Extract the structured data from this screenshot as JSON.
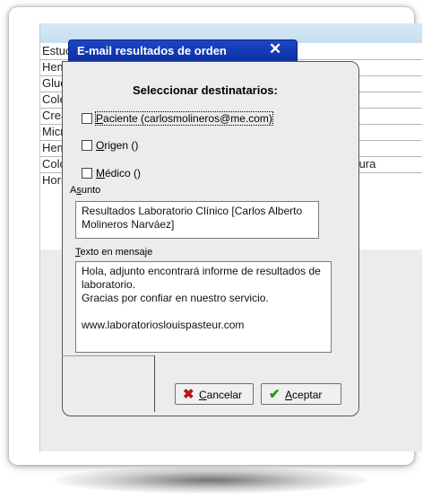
{
  "background_list": {
    "rows": [
      {
        "col1": "Estuc",
        "col2": ""
      },
      {
        "col1": "Hemo",
        "col2": ""
      },
      {
        "col1": "Gluco",
        "col2": "a"
      },
      {
        "col1": "Coles",
        "col2": ""
      },
      {
        "col1": "Creat",
        "col2": ""
      },
      {
        "col1": "Micro",
        "col2": ""
      },
      {
        "col1": "Hemo",
        "col2": "les"
      },
      {
        "col1": "Color",
        "col2": "Lectura"
      },
      {
        "col1": "Horm",
        "col2": ""
      }
    ]
  },
  "dialog": {
    "title": "E-mail resultados de orden",
    "close_glyph": "✕",
    "heading": "Seleccionar destinatarios:",
    "recipients": [
      {
        "hotkey": "P",
        "rest": "aciente (carlosmolineros@me.com)",
        "checked": false,
        "focused": true
      },
      {
        "hotkey": "O",
        "rest": "rigen ()",
        "checked": false,
        "focused": false
      },
      {
        "hotkey": "M",
        "rest": "édico ()",
        "checked": false,
        "focused": false
      }
    ],
    "subject_label_pre": "A",
    "subject_label_hot": "s",
    "subject_label_post": "unto",
    "subject_value": "Resultados Laboratorio Clínico [Carlos Alberto Molineros Narváez]",
    "message_label_hot": "T",
    "message_label_rest": "exto en mensaje",
    "message_lines": [
      "Hola, adjunto encontrará informe de resultados de laboratorio.",
      "Gracias por confiar en nuestro servicio.",
      "",
      "www.laboratorioslouispasteur.com"
    ],
    "cancel_button": {
      "hotkey": "C",
      "rest": "ancelar",
      "icon": "✖"
    },
    "accept_button": {
      "hotkey": "A",
      "rest": "ceptar",
      "icon": "✔"
    }
  },
  "colors": {
    "title_bar": "#0a2f9e",
    "cancel_icon": "#b01818",
    "accept_icon": "#1c9a1c",
    "header_strip": "#c8dff0"
  }
}
